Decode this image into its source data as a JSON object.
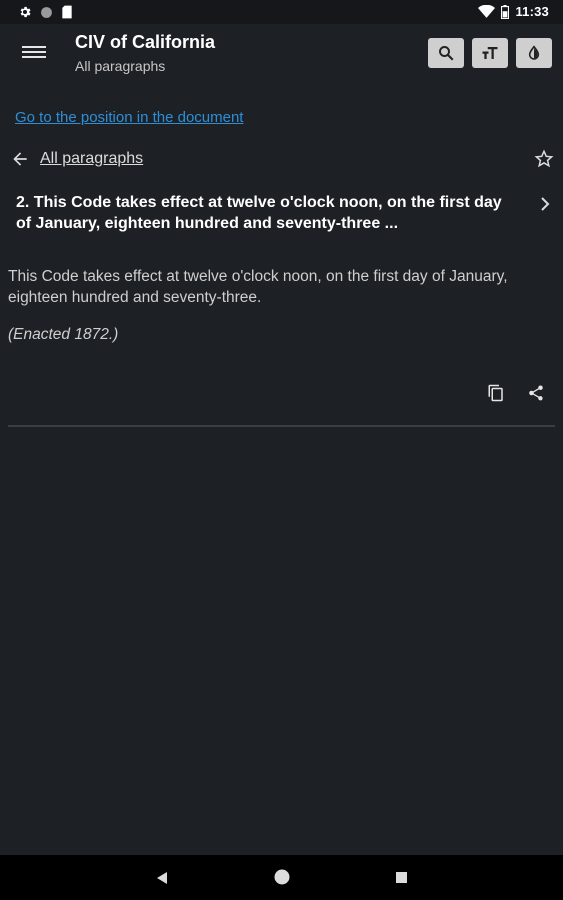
{
  "status_bar": {
    "time": "11:33",
    "left_icons": [
      "gear-icon",
      "circle-icon",
      "sd-card-icon"
    ],
    "right_icons": [
      "wifi-icon",
      "battery-icon"
    ]
  },
  "app_bar": {
    "title": "CIV of California",
    "subtitle": "All paragraphs",
    "actions": [
      "search-icon",
      "text-size-icon",
      "theme-drop-icon"
    ]
  },
  "content": {
    "goto_link": "Go to the position in the document",
    "back_label": "All paragraphs",
    "paragraph_title": "2. This Code takes effect at twelve o'clock noon, on the first day of January, eighteen hundred and seventy-three ...",
    "paragraph_body": "This Code takes effect at twelve o'clock noon, on the first day of January, eighteen hundred and seventy-three.",
    "paragraph_note": "(Enacted 1872.)"
  },
  "colors": {
    "background": "#1d2025",
    "link": "#2f8fd6",
    "action_button": "#cfcfcf"
  }
}
